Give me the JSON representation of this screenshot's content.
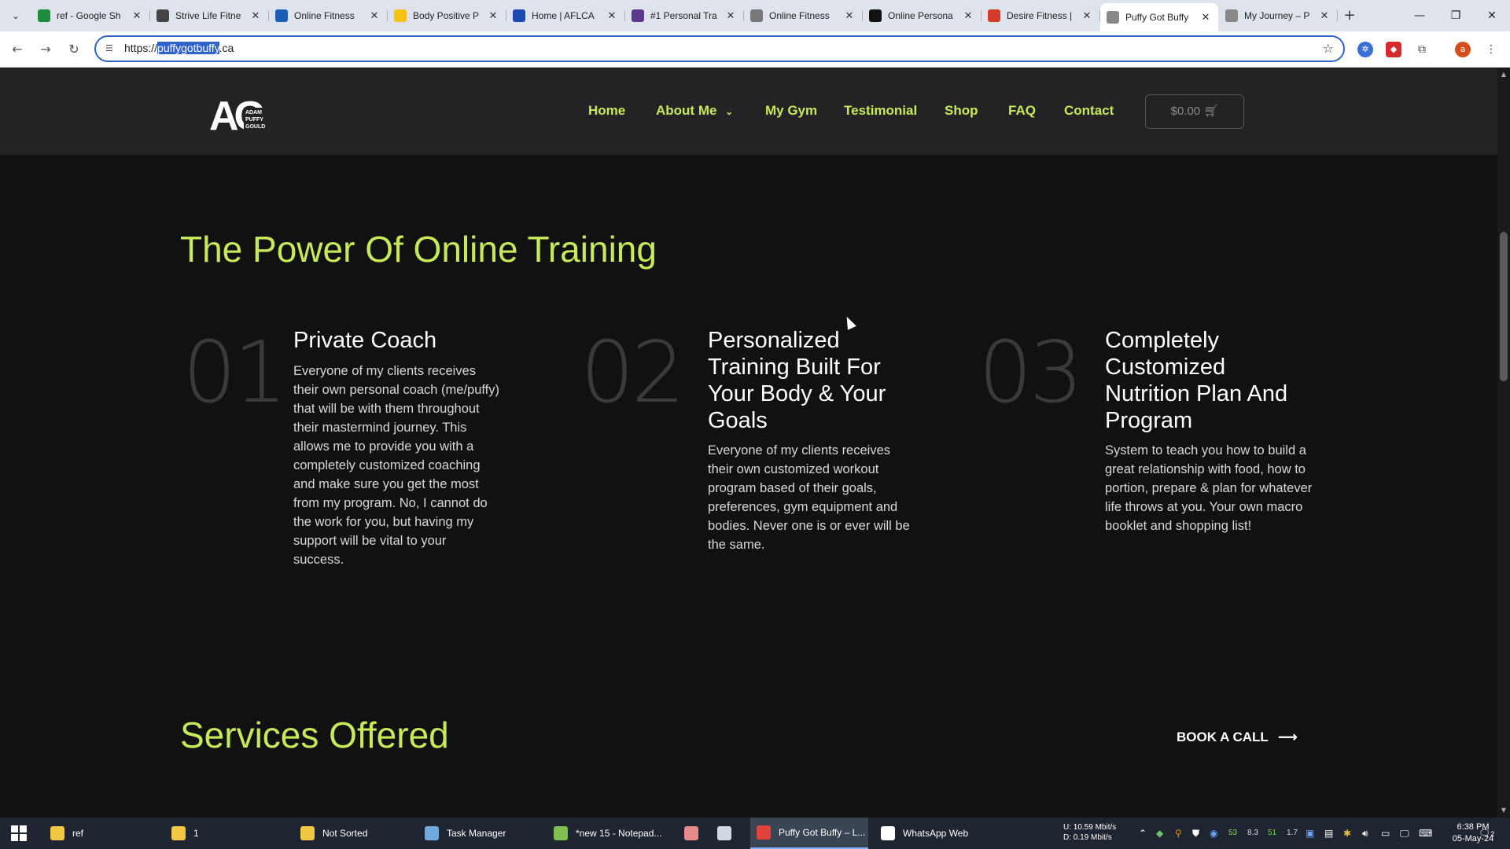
{
  "browser": {
    "tabs": [
      {
        "title": "ref - Google Sh",
        "favicon_color": "#1e8e3e",
        "active": false
      },
      {
        "title": "Strive Life Fitne",
        "favicon_color": "#444444",
        "active": false
      },
      {
        "title": "Online Fitness",
        "favicon_color": "#1a5fb4",
        "active": false
      },
      {
        "title": "Body Positive P",
        "favicon_color": "#f5c211",
        "active": false
      },
      {
        "title": "Home | AFLCA",
        "favicon_color": "#1c4bb0",
        "active": false
      },
      {
        "title": "#1 Personal Tra",
        "favicon_color": "#5b3a8c",
        "active": false
      },
      {
        "title": "Online Fitness",
        "favicon_color": "#777777",
        "active": false
      },
      {
        "title": "Online Persona",
        "favicon_color": "#111111",
        "active": false
      },
      {
        "title": "Desire Fitness |",
        "favicon_color": "#d33a2c",
        "active": false
      },
      {
        "title": "Puffy Got Buffy",
        "favicon_color": "#888888",
        "active": true
      },
      {
        "title": "My Journey – P",
        "favicon_color": "#888888",
        "active": false
      }
    ],
    "url_prefix": "https://",
    "url_selected": "puffygotbuffy",
    "url_suffix": ".ca"
  },
  "site": {
    "logo_text": "ADAM PUFFY GOULD",
    "logo_letters": "AG",
    "nav": [
      "Home",
      "About Me",
      "My Gym",
      "Testimonial",
      "Shop",
      "FAQ",
      "Contact"
    ],
    "cart": "$0.00",
    "accent": "#c8ea5a"
  },
  "training": {
    "heading": "The Power Of Online Training",
    "features": [
      {
        "number": "01",
        "title": "Private Coach",
        "text": "Everyone of my clients receives their own personal coach (me/puffy) that will be with them throughout their mastermind journey. This allows me to provide you with a completely customized coaching and make sure you get the most from my program. No, I cannot do the work for you, but having my support will be vital to your success."
      },
      {
        "number": "02",
        "title": "Personalized Training Built For Your Body & Your Goals",
        "text": "Everyone of my clients receives their own customized workout program based of their goals, preferences, gym equipment and bodies. Never one is or ever will be the same."
      },
      {
        "number": "03",
        "title": "Completely Customized Nutrition Plan And Program",
        "text": "System to teach you how to build a great relationship with food, how to portion, prepare & plan for whatever life throws at you. Your own macro booklet and shopping list!"
      }
    ]
  },
  "services": {
    "heading": "Services Offered",
    "cta": "BOOK A CALL",
    "cta_arrow": "⟶"
  },
  "taskbar": {
    "items": [
      {
        "label": "ref",
        "color": "#f2c744"
      },
      {
        "label": "1",
        "color": "#f2c744"
      },
      {
        "label": "Not Sorted",
        "color": "#f2c744"
      },
      {
        "label": "Task Manager",
        "color": "#6fa8dc"
      },
      {
        "label": "*new 15 - Notepad...",
        "color": "#7fbf4d"
      },
      {
        "label": "",
        "color": "#e88b8b"
      },
      {
        "label": "",
        "color": "#cfd8e3"
      },
      {
        "label": "Puffy Got Buffy – L...",
        "color": "#e0433a"
      },
      {
        "label": "WhatsApp Web",
        "color": "#ffffff"
      }
    ],
    "net_up": "U:",
    "net_up_value": "10.59 Mbit/s",
    "net_down": "D:",
    "net_down_value": "0.19 Mbit/s",
    "tray_nums": [
      "53",
      "8.3",
      "51",
      "1.7"
    ],
    "time": "6:38 PM",
    "date": "05-May-24",
    "notifications": "2"
  }
}
